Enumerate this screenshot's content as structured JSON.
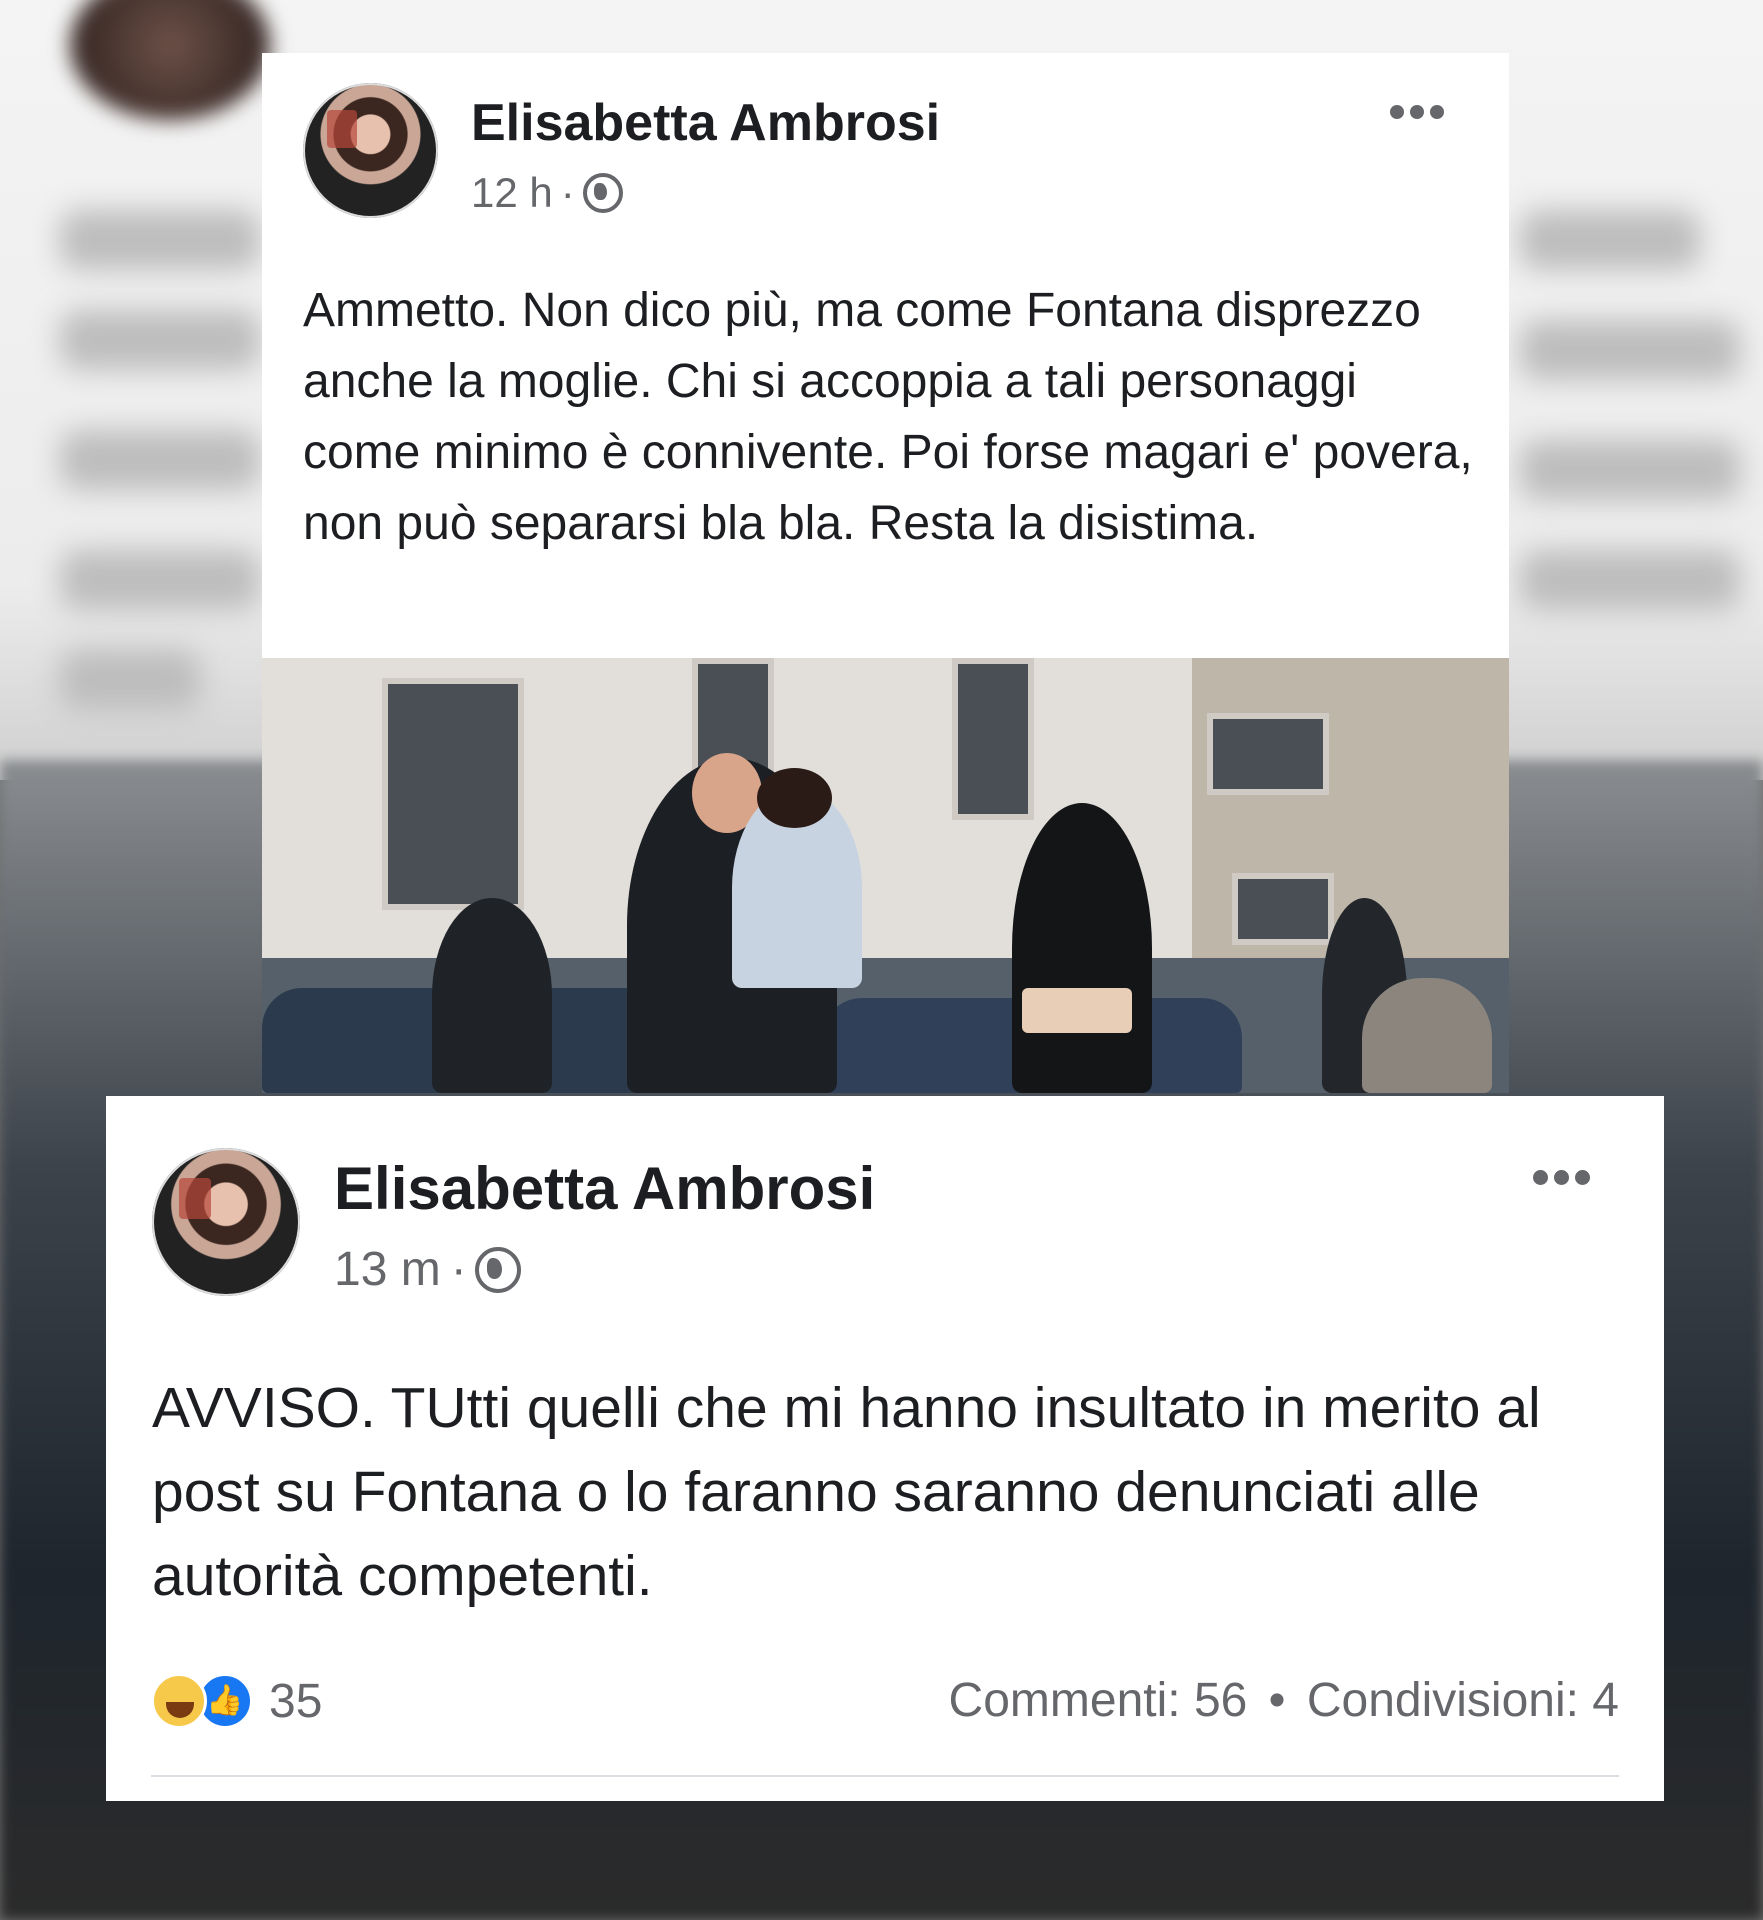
{
  "post1": {
    "author": "Elisabetta Ambrosi",
    "time": "12 h",
    "separator": "·",
    "text": "Ammetto. Non dico più, ma come Fontana disprezzo anche la moglie. Chi si accoppia a tali personaggi come minimo è connivente. Poi forse magari e' povera, non può separarsi bla bla. Resta la disistima.",
    "privacy_icon": "globe-icon",
    "more_icon": "more-options-icon"
  },
  "post2": {
    "author": "Elisabetta Ambrosi",
    "time": "13 m",
    "separator": "·",
    "text": "AVVISO. TUtti quelli che mi hanno insultato in merito al post su Fontana o lo faranno saranno denunciati alle autorità competenti.",
    "privacy_icon": "globe-icon",
    "more_icon": "more-options-icon",
    "reactions": {
      "icons": [
        "haha-icon",
        "like-icon"
      ],
      "count": "35",
      "comments": "Commenti: 56",
      "bullet": "•",
      "shares": "Condivisioni: 4"
    }
  },
  "colors": {
    "card_bg": "#ffffff",
    "text": "#1c1e21",
    "muted": "#65676b",
    "like_blue": "#1877f2",
    "haha_yellow": "#f7c94a"
  }
}
